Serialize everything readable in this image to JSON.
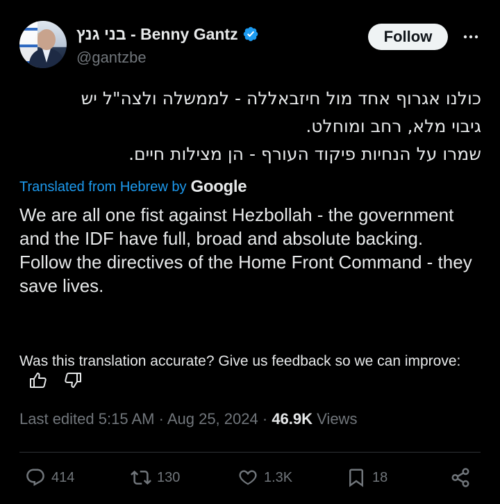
{
  "author": {
    "display_name": "בני גנץ - Benny Gantz",
    "handle": "@gantzbe"
  },
  "header": {
    "follow_label": "Follow"
  },
  "tweet": {
    "original_lines": [
      "כולנו אגרוף אחד מול חיזבאללה - לממשלה ולצה\"ל יש",
      "גיבוי מלא, רחב ומוחלט.",
      "שמרו על הנחיות פיקוד העורף - הן מצילות חיים."
    ],
    "translated_label": "Translated from Hebrew by",
    "translation_provider": "Google",
    "translation": "We are all one fist against Hezbollah - the government and the IDF have full, broad and absolute backing.\nFollow the directives of the Home Front Command - they save lives."
  },
  "feedback": {
    "prompt": "Was this translation accurate? Give us feedback so we can improve:"
  },
  "meta": {
    "edited_time": "Last edited 5:15 AM",
    "separator": "·",
    "date": "Aug 25, 2024",
    "views_count": "46.9K",
    "views_label": "Views"
  },
  "actions": {
    "replies": "414",
    "reposts": "130",
    "likes": "1.3K",
    "bookmarks": "18"
  },
  "colors": {
    "background": "#000000",
    "text": "#e7e9ea",
    "secondary": "#71767b",
    "link": "#1d9bf0",
    "verified": "#1d9bf0"
  }
}
